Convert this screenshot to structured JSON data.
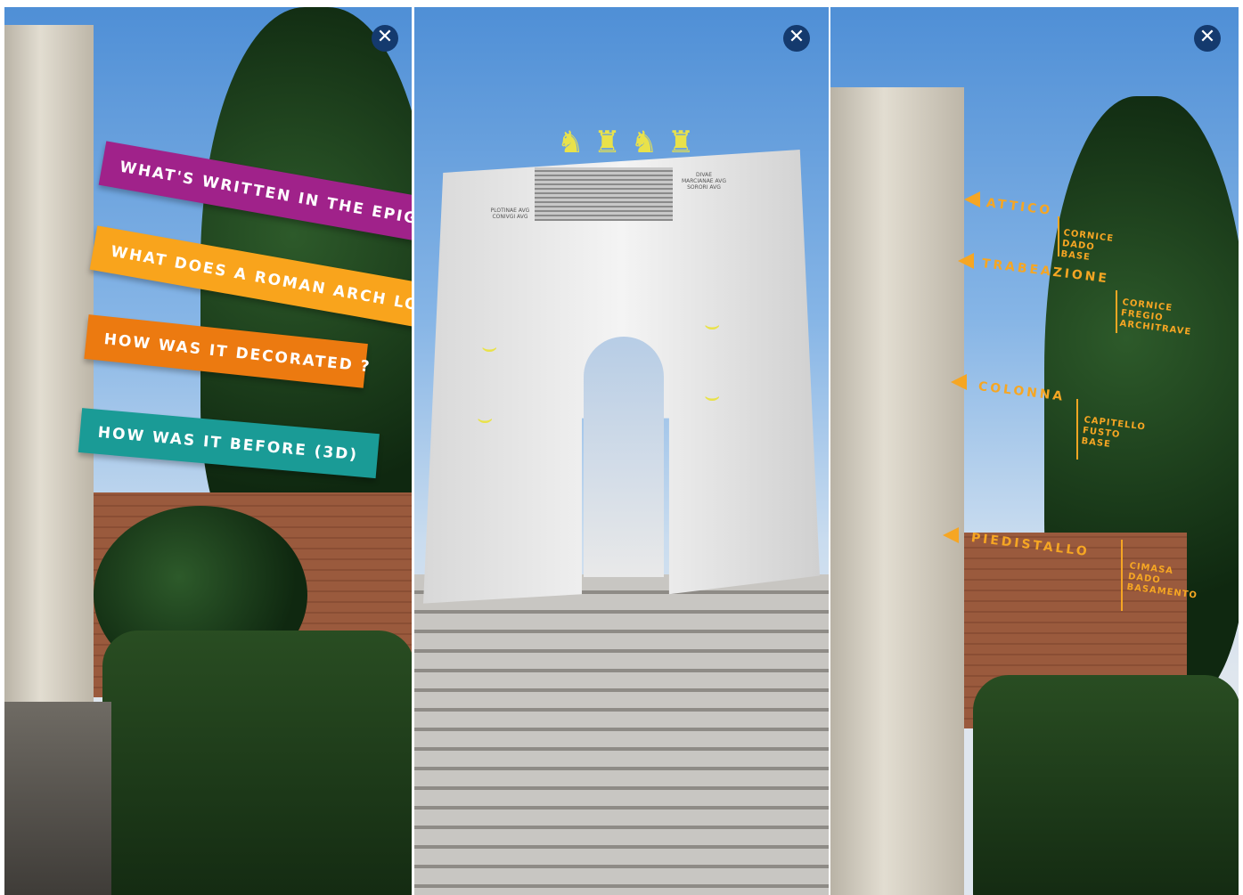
{
  "close_symbol": "✕",
  "panel_left": {
    "buttons": [
      {
        "label": "WHAT'S WRITTEN IN THE EPIGRAPH",
        "color": "#a0228a"
      },
      {
        "label": "WHAT DOES A ROMAN ARCH LOOK",
        "color": "#f9a41c"
      },
      {
        "label": "HOW WAS IT DECORATED ?",
        "color": "#ec7a10"
      },
      {
        "label": "HOW WAS IT BEFORE (3D)",
        "color": "#1a9b96"
      }
    ]
  },
  "panel_middle": {
    "inscriptions": [
      "PLOTINAE AVG CONIVGI AVG",
      "DIVAE MARCIANAE AVG SORORI AVG"
    ]
  },
  "panel_right": {
    "labels": [
      {
        "main": "ATTICO",
        "sub": "CORNICE\nDADO\nBASE"
      },
      {
        "main": "TRABEAZIONE",
        "sub": "CORNICE\nFREGIO\nARCHITRAVE"
      },
      {
        "main": "COLONNA",
        "sub": "CAPITELLO\nFUSTO\nBASE"
      },
      {
        "main": "PIEDISTALLO",
        "sub": "CIMASA\nDADO\nBASAMENTO"
      }
    ]
  },
  "colors": {
    "close_button": "#143a6e",
    "label_accent": "#f6a623",
    "gold_detail": "#e9e24a"
  }
}
